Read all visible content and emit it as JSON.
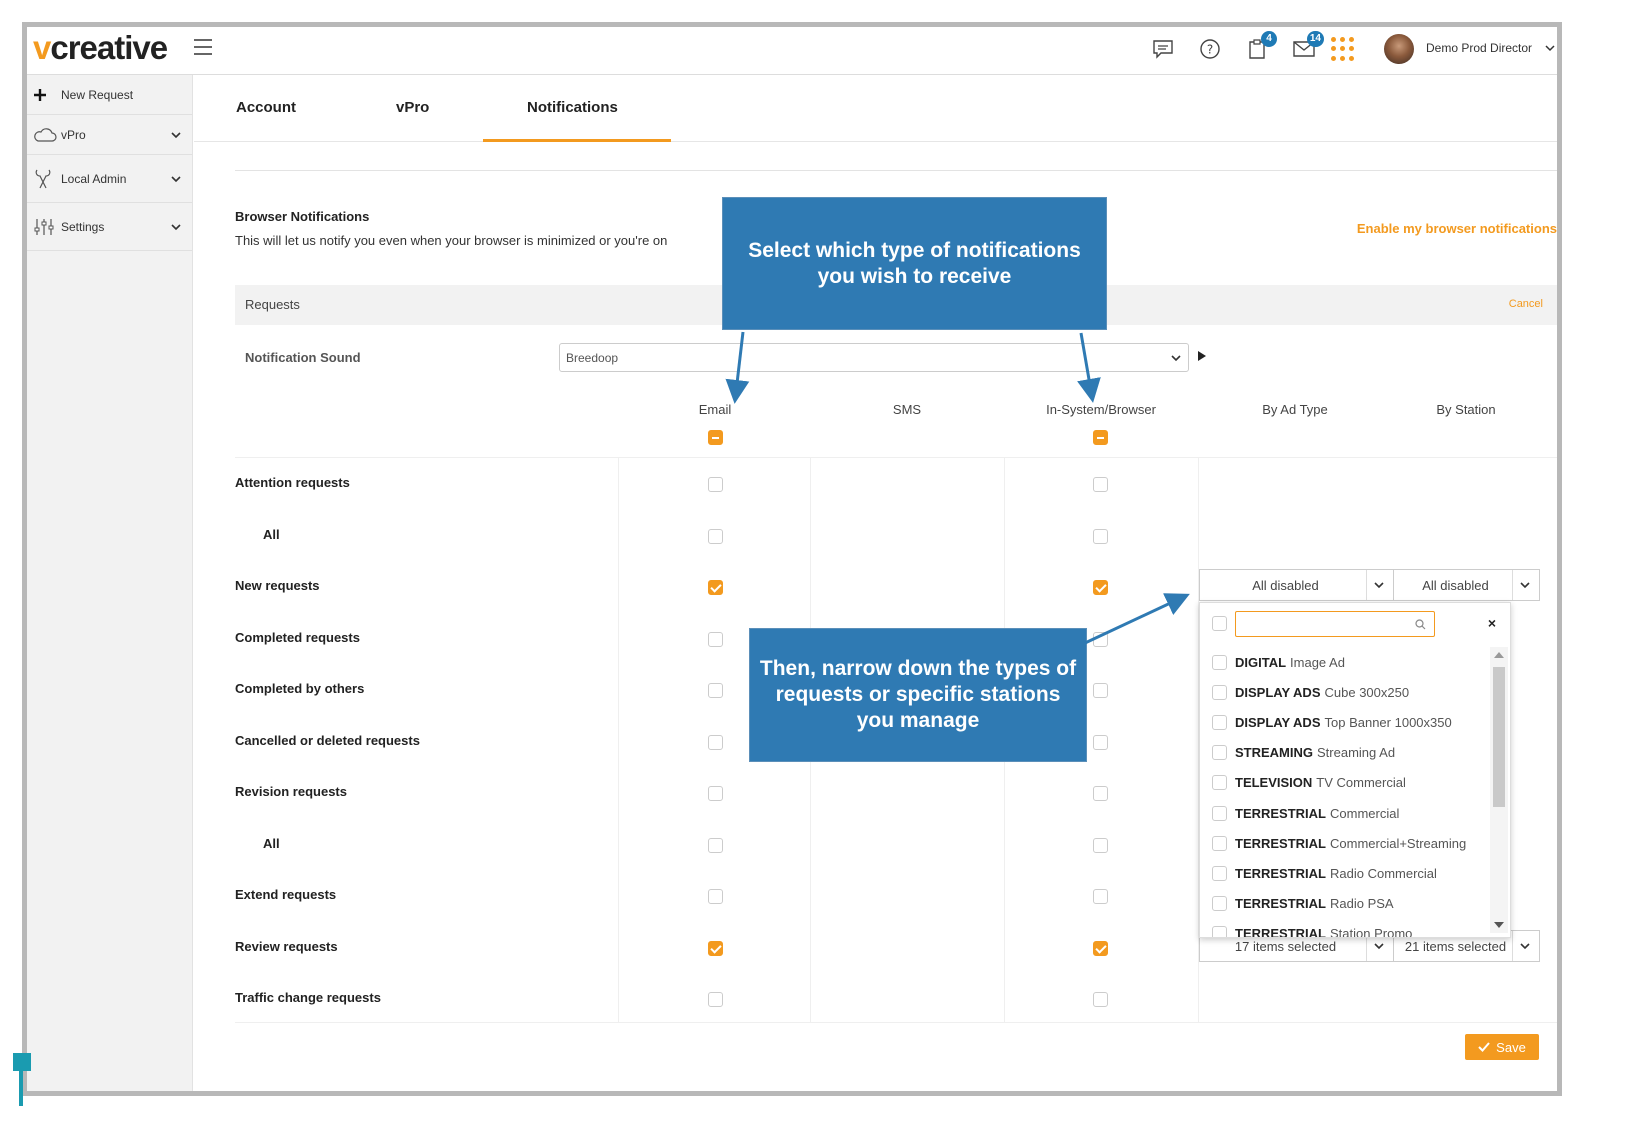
{
  "app": {
    "logo_prefix": "v",
    "logo_rest": "creative",
    "username": "Demo Prod Director"
  },
  "topbar": {
    "tasks_badge": "4",
    "messages_badge": "14"
  },
  "sidebar": {
    "items": [
      {
        "label": "New Request",
        "icon": "plus-icon"
      },
      {
        "label": "vPro",
        "icon": "cloud-icon"
      },
      {
        "label": "Local Admin",
        "icon": "tools-icon"
      },
      {
        "label": "Settings",
        "icon": "sliders-icon"
      }
    ]
  },
  "tabs": [
    "Account",
    "vPro",
    "Notifications"
  ],
  "active_tab": "Notifications",
  "browser_notifications": {
    "title": "Browser Notifications",
    "description": "This will let us notify you even when your browser is minimized or you're on",
    "enable_link": "Enable my browser notifications"
  },
  "requests_section": {
    "label": "Requests",
    "cancel": "Cancel"
  },
  "notification_sound": {
    "label": "Notification Sound",
    "value": "Breedoop"
  },
  "columns": [
    "Email",
    "SMS",
    "In-System/Browser",
    "By Ad Type",
    "By Station"
  ],
  "rows": [
    {
      "label": "Attention requests",
      "sub": false,
      "email": false,
      "browser": false
    },
    {
      "label": "All",
      "sub": true,
      "email": false,
      "browser": false
    },
    {
      "label": "New requests",
      "sub": false,
      "email": true,
      "browser": true,
      "ad_type": "All disabled",
      "station": "All disabled"
    },
    {
      "label": "Completed requests",
      "sub": false,
      "email": false,
      "browser": false
    },
    {
      "label": "Completed by others",
      "sub": false,
      "email": false,
      "browser": false
    },
    {
      "label": "Cancelled or deleted requests",
      "sub": false,
      "email": false,
      "browser": false
    },
    {
      "label": "Revision requests",
      "sub": false,
      "email": false,
      "browser": false
    },
    {
      "label": "All",
      "sub": true,
      "email": false,
      "browser": false
    },
    {
      "label": "Extend requests",
      "sub": false,
      "email": false,
      "browser": false
    },
    {
      "label": "Review requests",
      "sub": false,
      "email": true,
      "browser": true,
      "ad_type": "17 items selected",
      "station": "21 items selected"
    },
    {
      "label": "Traffic change requests",
      "sub": false,
      "email": false,
      "browser": false
    }
  ],
  "ad_type_dropdown": {
    "items": [
      {
        "category": "DIGITAL",
        "name": "Image Ad"
      },
      {
        "category": "DISPLAY ADS",
        "name": "Cube 300x250"
      },
      {
        "category": "DISPLAY ADS",
        "name": "Top Banner 1000x350"
      },
      {
        "category": "STREAMING",
        "name": "Streaming Ad"
      },
      {
        "category": "TELEVISION",
        "name": "TV Commercial"
      },
      {
        "category": "TERRESTRIAL",
        "name": "Commercial"
      },
      {
        "category": "TERRESTRIAL",
        "name": "Commercial+Streaming"
      },
      {
        "category": "TERRESTRIAL",
        "name": "Radio Commercial"
      },
      {
        "category": "TERRESTRIAL",
        "name": "Radio PSA"
      },
      {
        "category": "TERRESTRIAL",
        "name": "Station Promo"
      }
    ]
  },
  "save_label": "Save",
  "callouts": {
    "first": "Select which type of notifications you wish to receive",
    "second": "Then, narrow down the types of requests or specific stations you manage"
  },
  "colors": {
    "accent": "#f39a1f",
    "callout": "#2f7ab3",
    "badge": "#1f7ab5"
  }
}
